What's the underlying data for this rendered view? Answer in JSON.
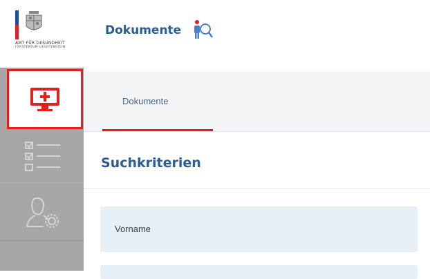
{
  "logo": {
    "line1": "AMT FÜR GESUNDHEIT",
    "line2": "FÜRSTENTUM LIECHTENSTEIN"
  },
  "header": {
    "title": "Dokumente"
  },
  "tabs": [
    {
      "label": "Dokumente",
      "active": true
    }
  ],
  "section": {
    "title": "Suchkriterien"
  },
  "form": {
    "fields": [
      {
        "label": "Vorname"
      }
    ]
  },
  "colors": {
    "accent_red": "#e0201f",
    "brand_blue": "#2c5c94",
    "sidebar_gray": "#a7a7a7",
    "field_bg": "#e8f0f7"
  },
  "icons": {
    "nav_active": "monitor-plus-icon",
    "nav_lists": "checklist-icon",
    "nav_user": "user-settings-icon",
    "header": "person-search-icon"
  }
}
